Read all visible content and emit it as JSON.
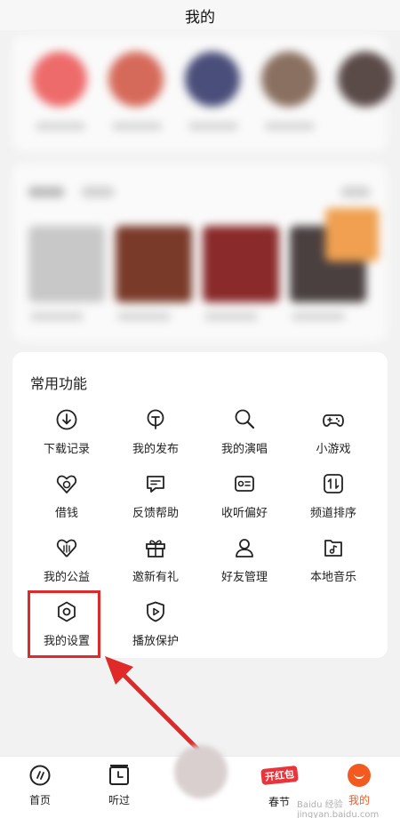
{
  "header": {
    "title": "我的"
  },
  "functions": {
    "title": "常用功能",
    "items": [
      {
        "label": "下载记录",
        "icon": "download-circle-icon"
      },
      {
        "label": "我的发布",
        "icon": "publish-icon"
      },
      {
        "label": "我的演唱",
        "icon": "microphone-icon"
      },
      {
        "label": "小游戏",
        "icon": "gamepad-icon"
      },
      {
        "label": "借钱",
        "icon": "loan-icon"
      },
      {
        "label": "反馈帮助",
        "icon": "feedback-icon"
      },
      {
        "label": "收听偏好",
        "icon": "preference-icon"
      },
      {
        "label": "频道排序",
        "icon": "sort-icon"
      },
      {
        "label": "我的公益",
        "icon": "charity-icon"
      },
      {
        "label": "邀新有礼",
        "icon": "gift-icon"
      },
      {
        "label": "好友管理",
        "icon": "friend-icon"
      },
      {
        "label": "本地音乐",
        "icon": "local-music-icon"
      },
      {
        "label": "我的设置",
        "icon": "settings-hexagon-icon"
      },
      {
        "label": "播放保护",
        "icon": "play-protect-icon"
      }
    ]
  },
  "navbar": {
    "items": [
      {
        "label": "首页",
        "icon": "home-disc-icon"
      },
      {
        "label": "听过",
        "icon": "history-clock-icon"
      },
      {
        "label": "春节",
        "badge": "开红包",
        "icon": "red-envelope-icon"
      },
      {
        "label": "我的",
        "icon": "mine-avatar-icon"
      }
    ]
  },
  "watermark": "Baidu 经验 jingyan.baidu.com",
  "colors": {
    "highlight": "#e02a2a",
    "accent": "#f25a1f",
    "badge": "#e8343a"
  }
}
